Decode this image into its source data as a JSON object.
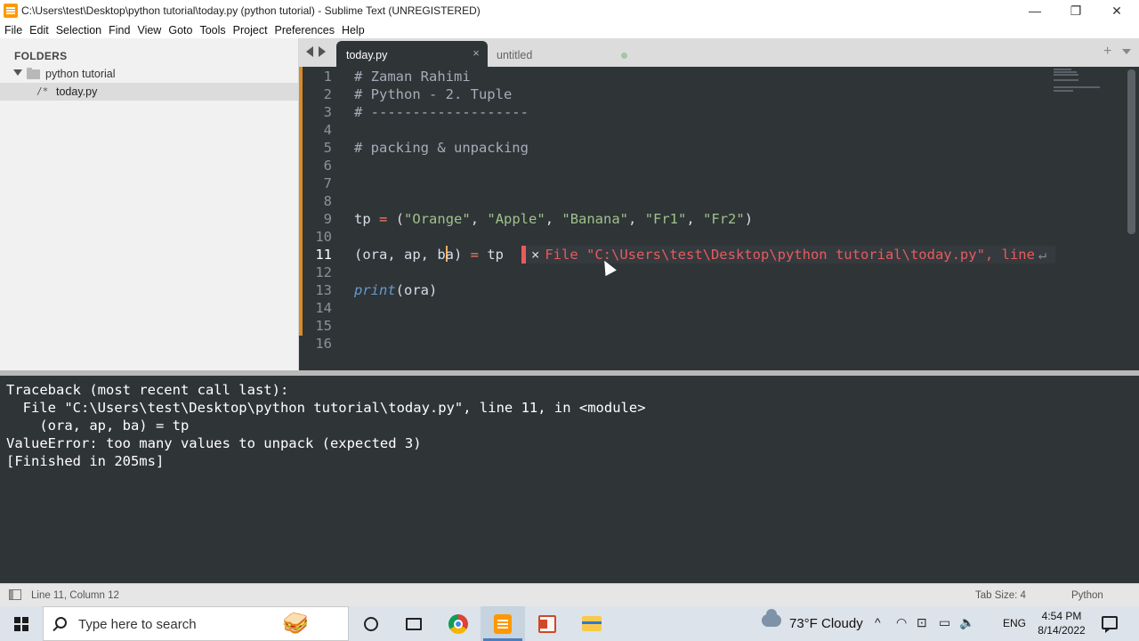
{
  "window": {
    "title": "C:\\Users\\test\\Desktop\\python tutorial\\today.py (python tutorial) - Sublime Text (UNREGISTERED)",
    "controls": {
      "minimize": "—",
      "maximize": "❐",
      "close": "✕"
    }
  },
  "menu": [
    "File",
    "Edit",
    "Selection",
    "Find",
    "View",
    "Goto",
    "Tools",
    "Project",
    "Preferences",
    "Help"
  ],
  "sidebar": {
    "header": "FOLDERS",
    "folder": "python tutorial",
    "file_icon": "/*",
    "file": "today.py"
  },
  "tabs": [
    {
      "label": "today.py",
      "close": "×",
      "active": true
    },
    {
      "label": "untitled",
      "active": false,
      "dirty": true
    }
  ],
  "tabbar": {
    "new_tab": "+"
  },
  "editor": {
    "line_numbers": [
      "1",
      "2",
      "3",
      "4",
      "5",
      "6",
      "7",
      "8",
      "9",
      "10",
      "11",
      "12",
      "13",
      "14",
      "15",
      "16"
    ],
    "current_line": 11,
    "lines": {
      "l1": "# Zaman Rahimi",
      "l2": "# Python - 2. Tuple",
      "l3": "# -------------------",
      "l5": "# packing & unpacking",
      "l9": {
        "var": "tp",
        "eq": "=",
        "open": " (",
        "s1": "\"Orange\"",
        "c1": ", ",
        "s2": "\"Apple\"",
        "c2": ", ",
        "s3": "\"Banana\"",
        "c3": ", ",
        "s4": "\"Fr1\"",
        "c4": ", ",
        "s5": "\"Fr2\"",
        "close": ")"
      },
      "l11": {
        "pre": "(ora, ap, b",
        "post": "a) ",
        "eq": "=",
        "rhs": " tp"
      },
      "l13": {
        "fn": "print",
        "args": "(ora)"
      }
    },
    "error_phantom": {
      "close": "×",
      "text": "File \"C:\\Users\\test\\Desktop\\python tutorial\\today.py\", line",
      "wrap_icon": "↵"
    }
  },
  "output": [
    "Traceback (most recent call last):",
    "  File \"C:\\Users\\test\\Desktop\\python tutorial\\today.py\", line 11, in <module>",
    "    (ora, ap, ba) = tp",
    "ValueError: too many values to unpack (expected 3)",
    "[Finished in 205ms]"
  ],
  "statusbar": {
    "cursor": "Line 11, Column 12",
    "tab_size": "Tab Size: 4",
    "syntax": "Python"
  },
  "taskbar": {
    "search_placeholder": "Type here to search",
    "search_decoration": "🥪",
    "weather": "73°F  Cloudy",
    "tray": {
      "chevron": "^",
      "network": "◠",
      "meet": "⊡",
      "battery": "▭",
      "volume": "🔈"
    },
    "language": "ENG",
    "time": "4:54 PM",
    "date": "8/14/2022"
  },
  "colors": {
    "editor_bg": "#2f3437",
    "comment": "#a6acb9",
    "string": "#9fc28a",
    "operator": "#f77d5b",
    "function": "#6699cc",
    "error": "#e95b5b",
    "caret": "#f9ae58",
    "modified_gutter": "#d78a2a"
  },
  "icons": [
    "sublime-text-icon",
    "search-icon",
    "cortana-icon",
    "task-view-icon",
    "chrome-icon",
    "sublime-taskbar-icon",
    "powerpoint-icon",
    "file-explorer-icon",
    "weather-cloud-icon",
    "notification-icon"
  ]
}
